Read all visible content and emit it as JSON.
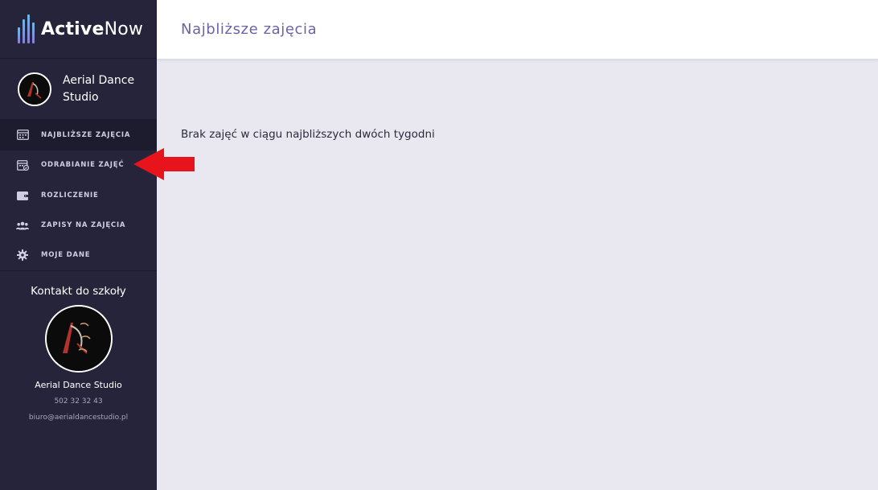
{
  "brand": {
    "name_bold": "Active",
    "name_regular": "Now"
  },
  "school": {
    "name": "Aerial Dance Studio"
  },
  "nav": {
    "items": [
      {
        "label": "NAJBLIŻSZE ZAJĘCIA",
        "icon": "calendar-icon",
        "active": true
      },
      {
        "label": "ODRABIANIE ZAJĘĆ",
        "icon": "calendar-check-icon",
        "active": false
      },
      {
        "label": "ROZLICZENIE",
        "icon": "wallet-icon",
        "active": false
      },
      {
        "label": "ZAPISY NA ZAJĘCIA",
        "icon": "users-icon",
        "active": false
      },
      {
        "label": "MOJE DANE",
        "icon": "gear-icon",
        "active": false
      }
    ]
  },
  "contact": {
    "title": "Kontakt do szkoły",
    "name": "Aerial Dance Studio",
    "phone": "502 32 32 43",
    "email": "biuro@aerialdancestudio.pl"
  },
  "header": {
    "title": "Najbliższe zajęcia"
  },
  "main": {
    "empty_message": "Brak zajęć w ciągu najbliższych dwóch tygodni"
  },
  "colors": {
    "sidebar_bg": "#25243a",
    "active_item_bg": "#1d1c2f",
    "header_title": "#6c63a6",
    "page_bg": "#e9e8f1",
    "annotation_arrow": "#e8141c"
  }
}
